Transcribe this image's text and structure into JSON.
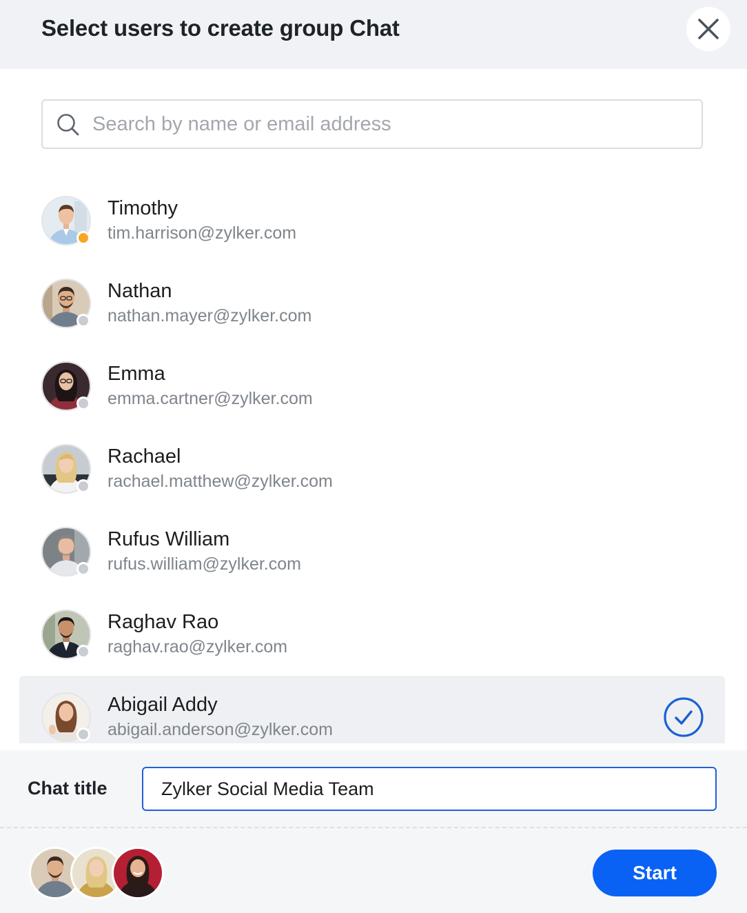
{
  "dialog": {
    "title": "Select users to create group Chat"
  },
  "search": {
    "placeholder": "Search by name or email address",
    "value": ""
  },
  "users": [
    {
      "name": "Timothy",
      "email": "tim.harrison@zylker.com",
      "status_color": "#f5a623",
      "selected": false
    },
    {
      "name": "Nathan",
      "email": "nathan.mayer@zylker.com",
      "status_color": "#c9ccd1",
      "selected": false
    },
    {
      "name": "Emma",
      "email": "emma.cartner@zylker.com",
      "status_color": "#c9ccd1",
      "selected": false
    },
    {
      "name": "Rachael",
      "email": "rachael.matthew@zylker.com",
      "status_color": "#c9ccd1",
      "selected": false
    },
    {
      "name": "Rufus William",
      "email": "rufus.william@zylker.com",
      "status_color": "#c9ccd1",
      "selected": false
    },
    {
      "name": "Raghav Rao",
      "email": "raghav.rao@zylker.com",
      "status_color": "#c9ccd1",
      "selected": false
    },
    {
      "name": "Abigail Addy",
      "email": "abigail.anderson@zylker.com",
      "status_color": "#c9ccd1",
      "selected": true
    }
  ],
  "footer": {
    "chat_title_label": "Chat title",
    "chat_title_value": "Zylker Social Media Team",
    "start_label": "Start"
  },
  "colors": {
    "accent": "#0a62f5",
    "online": "#f5a623",
    "offline": "#c9ccd1"
  }
}
